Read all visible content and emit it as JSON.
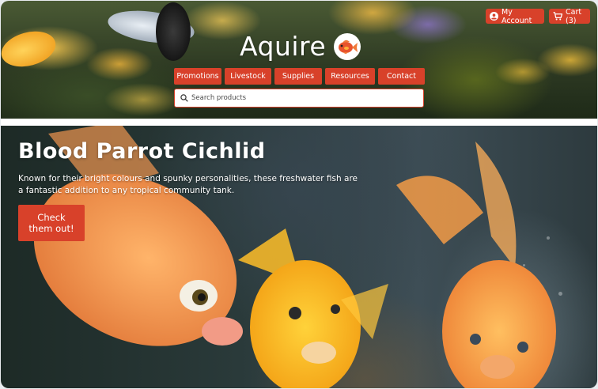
{
  "header": {
    "account_label": "My Account",
    "cart_label": "Cart (3)",
    "logo_text": "Aquire",
    "logo_icon": "goldfish-icon"
  },
  "nav": {
    "items": [
      {
        "label": "Promotions"
      },
      {
        "label": "Livestock"
      },
      {
        "label": "Supplies"
      },
      {
        "label": "Resources"
      },
      {
        "label": "Contact"
      }
    ]
  },
  "search": {
    "placeholder": "Search products",
    "icon": "search-icon"
  },
  "hero": {
    "title": "Blood Parrot Cichlid",
    "description": "Known for their bright colours and spunky personalities, these freshwater fish are a fantastic addition to any tropical community tank.",
    "cta_label": "Check them out!"
  },
  "colors": {
    "accent": "#d8412a",
    "text_on_accent": "#ffffff"
  }
}
